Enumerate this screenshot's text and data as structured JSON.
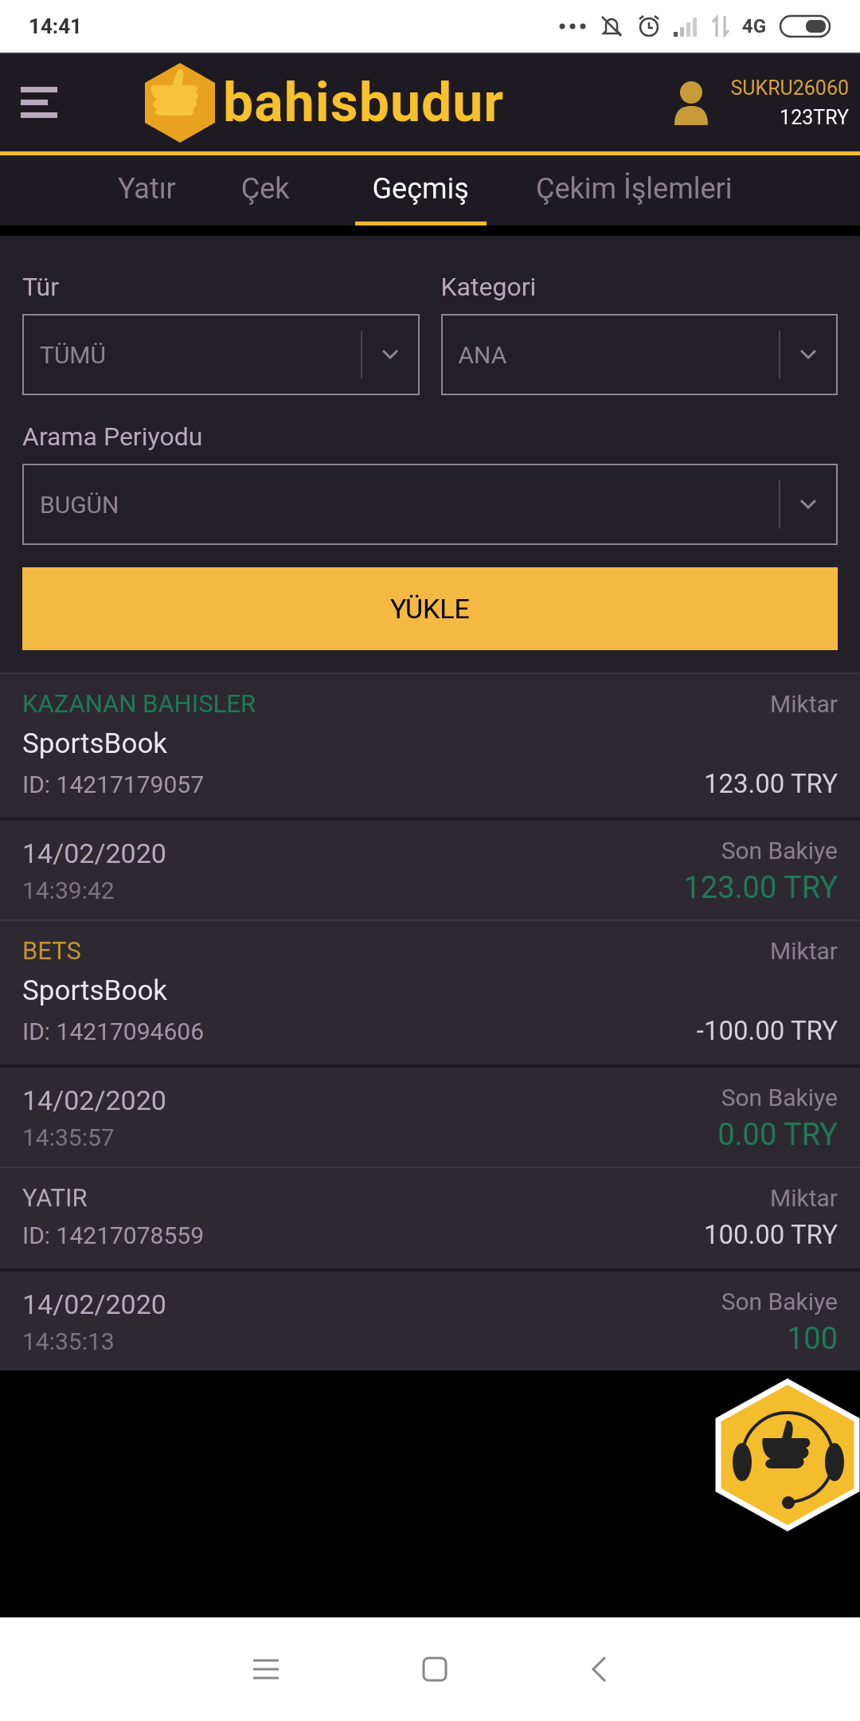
{
  "status_bar": {
    "time": "14:41",
    "network": "4G"
  },
  "header": {
    "brand": "bahisbudur",
    "username": "SUKRU26060",
    "balance": "123TRY"
  },
  "tabs": [
    {
      "label": "Yatır",
      "selected": false
    },
    {
      "label": "Çek",
      "selected": false
    },
    {
      "label": "Geçmiş",
      "selected": true
    },
    {
      "label": "Çekim İşlemleri",
      "selected": false
    }
  ],
  "filters": [
    {
      "label": "Tür",
      "value": "TÜMÜ"
    },
    {
      "label": "Kategori",
      "value": "ANA"
    },
    {
      "label": "Arama Periyodu",
      "value": "BUGÜN"
    }
  ],
  "load_button": "YÜKLE",
  "transactions": [
    {
      "category": "KAZANAN BAHISLER",
      "color": "#1f7a56",
      "product": "SportsBook",
      "id": "ID: 14217179057",
      "amount_label": "Miktar",
      "amount": "123.00 TRY",
      "date": "14/02/2020",
      "time": "14:39:42",
      "balance_label": "Son Bakiye",
      "balance": "123.00 TRY"
    },
    {
      "category": "BETS",
      "color": "#c3952f",
      "product": "SportsBook",
      "id": "ID: 14217094606",
      "amount_label": "Miktar",
      "amount": "-100.00 TRY",
      "date": "14/02/2020",
      "time": "14:35:57",
      "balance_label": "Son Bakiye",
      "balance": "0.00 TRY"
    },
    {
      "category": "YATIR",
      "color": "#b3a6b8",
      "id": "ID: 14217078559",
      "amount_label": "Miktar",
      "amount": "100.00 TRY",
      "date": "14/02/2020",
      "time": "14:35:13",
      "balance_label": "Son Bakiye",
      "balance": "100"
    }
  ]
}
